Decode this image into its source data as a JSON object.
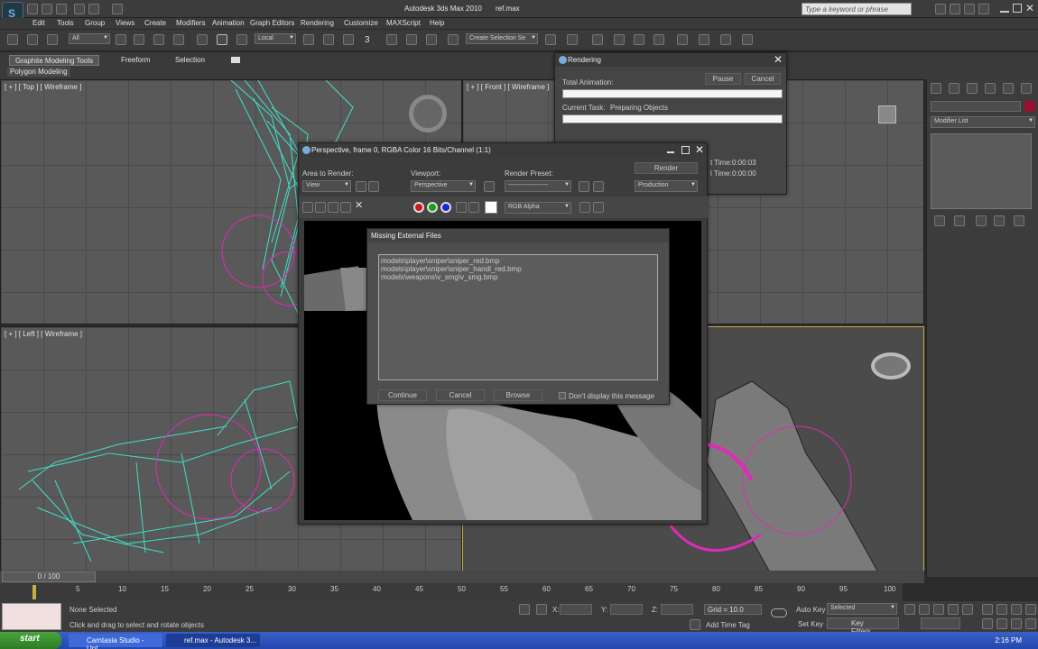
{
  "app": {
    "title": "Autodesk 3ds Max  2010",
    "document": "ref.max",
    "search_placeholder": "Type a keyword or phrase"
  },
  "menu": [
    "Edit",
    "Tools",
    "Group",
    "Views",
    "Create",
    "Modifiers",
    "Animation",
    "Graph Editors",
    "Rendering",
    "Customize",
    "MAXScript",
    "Help"
  ],
  "toolbar": {
    "selection_filter": "All",
    "coordinate_system": "Local",
    "named_selection": "Create Selection Se",
    "snap_label": "3"
  },
  "ribbon": {
    "tabs": [
      "Graphite Modeling Tools",
      "Freeform",
      "Selection"
    ],
    "active_tab": "Graphite Modeling Tools",
    "panel": "Polygon Modeling"
  },
  "viewports": {
    "top": "[ + ] [ Top ] [ Wireframe ]",
    "front": "[ + ] [ Front ] [ Wireframe ]",
    "left": "[ + ] [ Left ] [ Wireframe ]"
  },
  "command_panel": {
    "modifier_list": "Modifier List"
  },
  "rendering_dialog": {
    "title": "Rendering",
    "pause": "Pause",
    "cancel": "Cancel",
    "total_animation": "Total Animation:",
    "current_task_label": "Current Task:",
    "current_task_value": "Preparing Objects",
    "time1_label": "t Time:",
    "time1_value": "0:00:03",
    "time2_label": "l Time:",
    "time2_value": "0:00:00"
  },
  "frame_window": {
    "title": "Perspective, frame 0, RGBA Color 16 Bits/Channel (1:1)",
    "area_to_render_label": "Area to Render:",
    "area_to_render": "View",
    "viewport_label": "Viewport:",
    "viewport": "Perspective",
    "render_preset_label": "Render Preset:",
    "render_preset": "-------------------",
    "render_button": "Render",
    "production": "Production",
    "channel": "RGB Alpha"
  },
  "missing_files_dialog": {
    "title": "Missing External Files",
    "files": [
      "models\\player\\sniper\\sniper_red.bmp",
      "models\\player\\sniper\\sniper_handl_red.bmp",
      "models\\weapons\\v_smg\\v_smg.bmp"
    ],
    "continue": "Continue",
    "cancel": "Cancel",
    "browse": "Browse",
    "dont_display": "Don't display this message",
    "dont_display_checked": false
  },
  "timeline": {
    "frame_display": "0 / 100",
    "ticks": [
      "5",
      "10",
      "15",
      "20",
      "25",
      "30",
      "35",
      "40",
      "45",
      "50",
      "55",
      "60",
      "65",
      "70",
      "75",
      "80",
      "85",
      "90",
      "95",
      "100"
    ]
  },
  "status": {
    "selection": "None Selected",
    "prompt": "Click and drag to select and rotate objects",
    "x_label": "X:",
    "y_label": "Y:",
    "z_label": "Z:",
    "grid": "Grid = 10.0",
    "add_time_tag": "Add Time Tag",
    "auto_key": "Auto Key",
    "set_key": "Set Key",
    "key_mode": "Selected",
    "key_filters": "Key Filters..."
  },
  "taskbar": {
    "start": "start",
    "tasks": [
      "Camtasia Studio - Unt...",
      "ref.max - Autodesk 3..."
    ],
    "clock": "2:16 PM"
  },
  "colors": {
    "wire_cyan": "#3fe0c8",
    "wire_magenta": "#e02ab8",
    "viewport_bg": "#595959",
    "dialog_bg": "#454545"
  }
}
